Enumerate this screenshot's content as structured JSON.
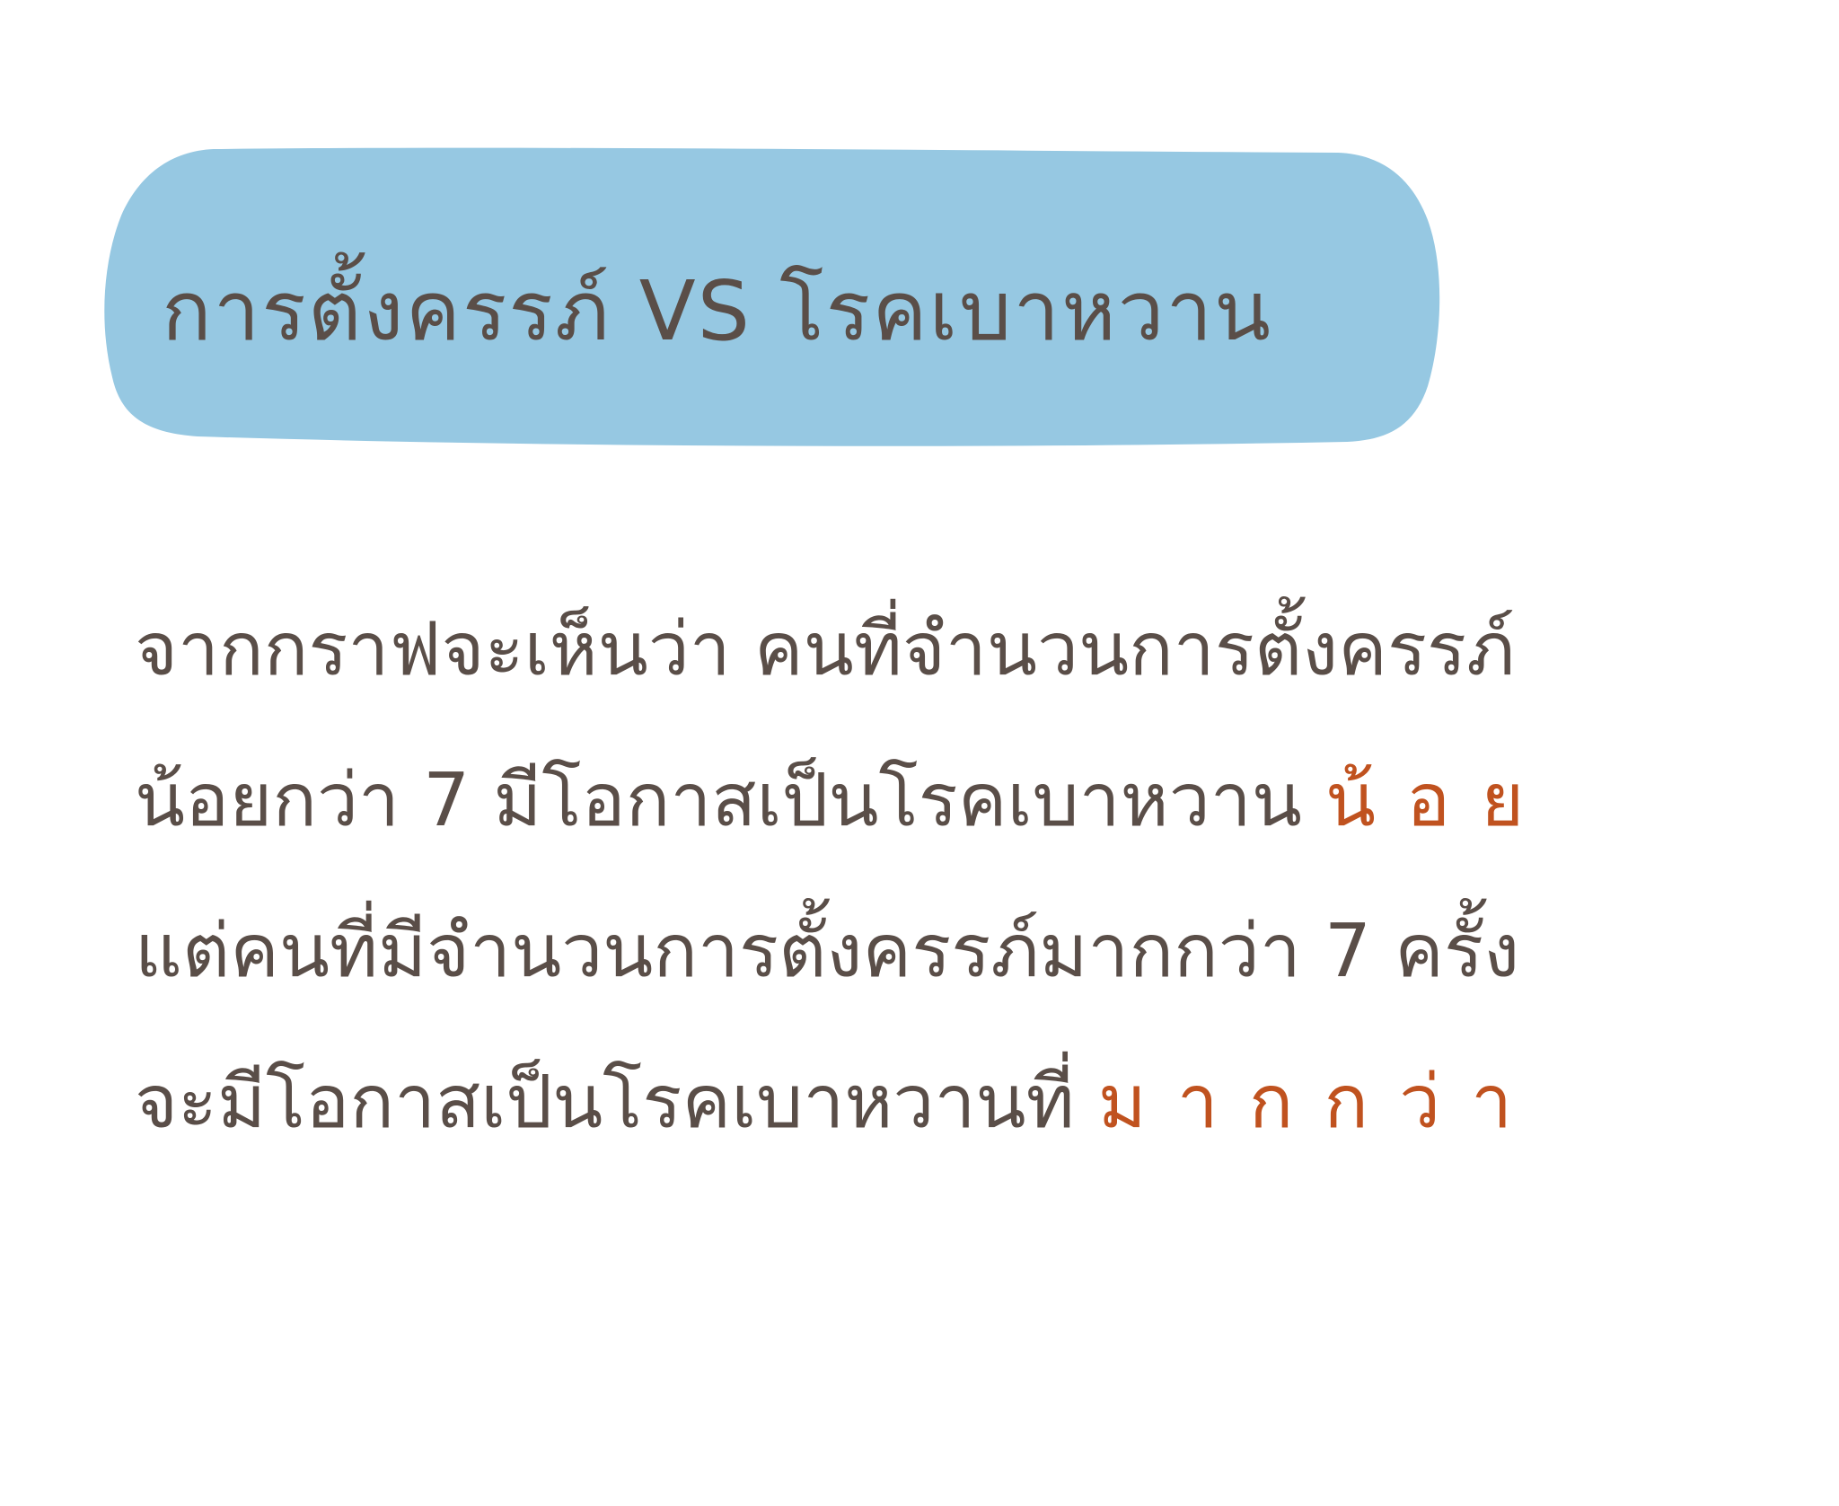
{
  "title": "การตั้งครรภ์ VS โรคเบาหวาน",
  "body": {
    "line1": "จากกราฟจะเห็นว่า คนที่จำนวนการตั้งครรภ์",
    "line2_pre": "น้อยกว่า 7 มีโอกาสเป็นโรคเบาหวาน ",
    "line2_em": "น้อย",
    "line3": "แต่คนที่มีจำนวนการตั้งครรภ์มากกว่า 7 ครั้ง",
    "line4_pre": "จะมีโอกาสเป็นโรคเบาหวานที่ ",
    "line4_em": "มากกว่า"
  },
  "colors": {
    "title_band": "#96c8e2",
    "text": "#5a4e48",
    "emphasis": "#c0521f"
  }
}
